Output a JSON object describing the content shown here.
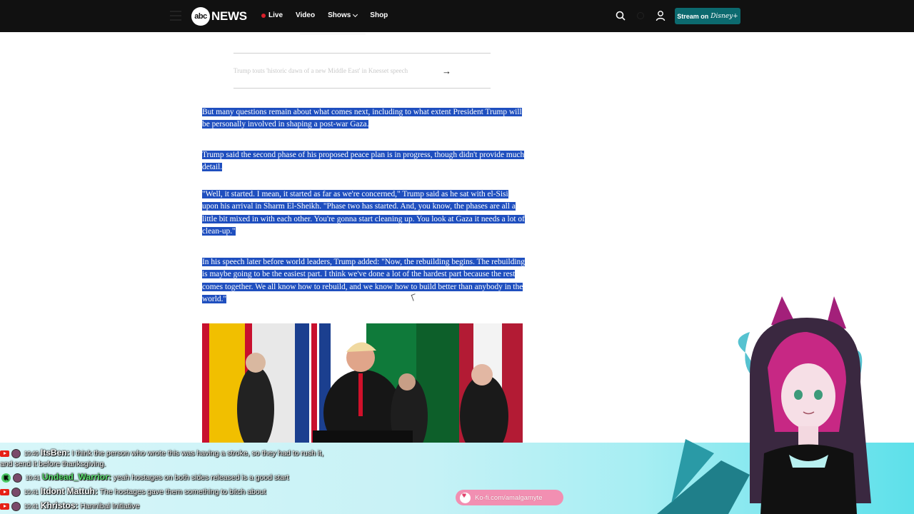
{
  "nav": {
    "logo_mark": "abc",
    "logo_text": "NEWS",
    "links": {
      "live": "Live",
      "video": "Video",
      "shows": "Shows",
      "shop": "Shop"
    },
    "stream_label": "Stream on",
    "stream_brand": "Disney+"
  },
  "article": {
    "related_link": "Trump touts 'historic dawn of a new Middle East' in Knesset speech",
    "paragraphs": [
      "But many questions remain about what comes next, including to what extent President Trump will be personally involved in shaping a post-war Gaza.",
      "Trump said the second phase of his proposed peace plan is in progress, though didn't provide much detail.",
      "\"Well, it started. I mean, it started as far as we're concerned,\" Trump said as he sat with el-Sisi upon his arrival in Sharm El-Sheikh. \"Phase two has started. And, you know, the phases are all a little bit mixed in with each other. You're gonna start cleaning up. You look at Gaza it needs a lot of clean-up.\"",
      "In his speech later before world leaders, Trump added: \"Now, the rebuilding begins. The rebuilding is maybe going to be the easiest part. I think we've done a lot of the hardest part because the rest comes together. We all know how to rebuild, and we know how to build better than anybody in the world.\""
    ]
  },
  "chat": {
    "messages": [
      {
        "time": "10:40",
        "user": "ItsBen:",
        "text": "I think the person who wrote this was having a stroke, so they had to rush it,",
        "text2": "and send it before thanksgiving."
      },
      {
        "time": "10:41",
        "user": "Undead_Warrior:",
        "text": "yeah hostages on both sides released is a good start",
        "badge": "K"
      },
      {
        "time": "10:41",
        "user": "Itdont Mattuh:",
        "text": "The hostages gave them something to bitch about"
      },
      {
        "time": "10:41",
        "user": "Khristos:",
        "text": "Hannibal Initiative"
      }
    ]
  },
  "kofi": {
    "label": "Ko-fi.com/amalgamyte"
  },
  "colors": {
    "nav_bg": "#111111",
    "stream_button": "#0c6a6f",
    "selection": "#1f4fbf",
    "live_dot": "#d9202a",
    "kofi": "#f28fb2",
    "chat_band": "#a7eef3"
  }
}
